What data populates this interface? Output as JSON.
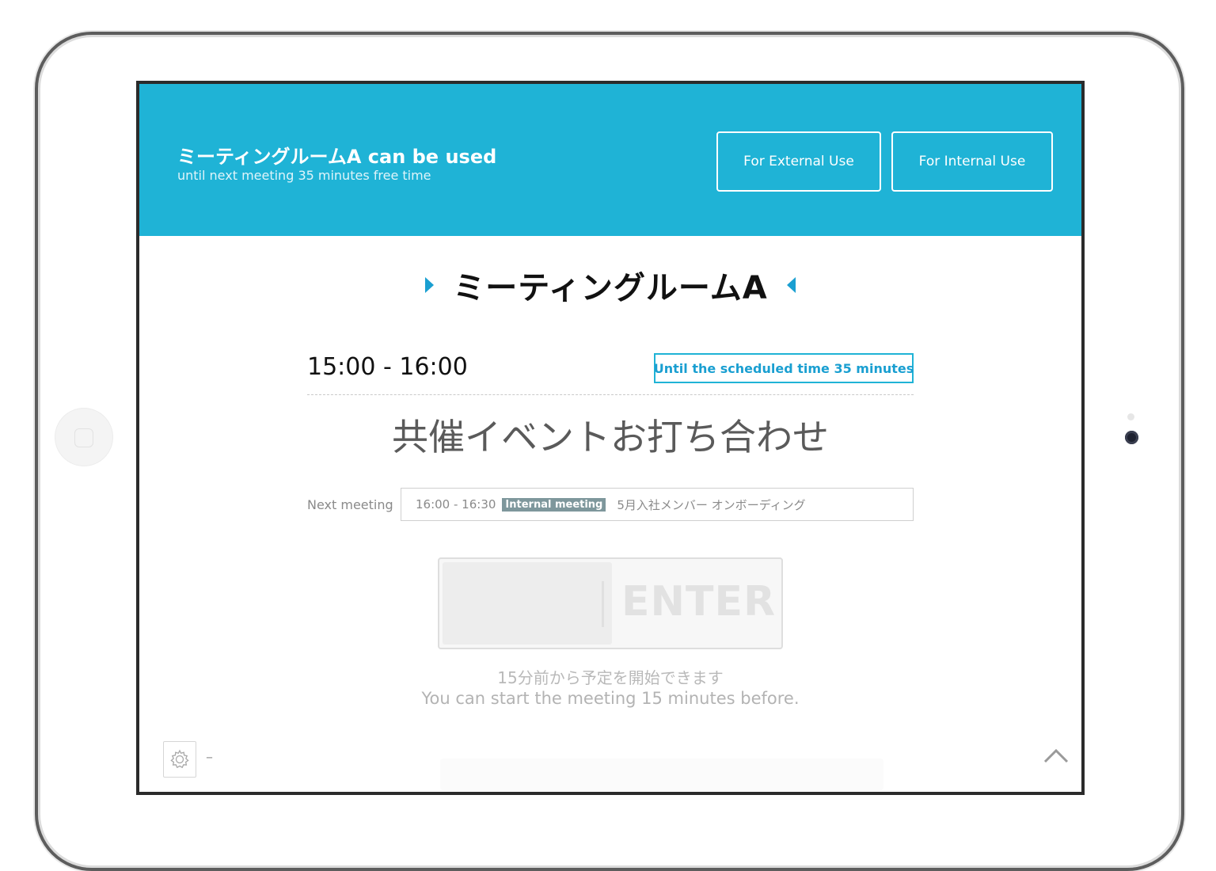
{
  "header": {
    "title": "ミーティングルームA can be used",
    "subtitle": "until next meeting 35 minutes free time",
    "external_button": "For External Use",
    "internal_button": "For Internal Use",
    "bg_color": "#1fb3d6"
  },
  "room": {
    "name": "ミーティングルームA",
    "arrow_color": "#1a9fd1"
  },
  "current_meeting": {
    "time_range": "15:00 - 16:00",
    "until_badge": "Until the scheduled time 35 minutes",
    "title": "共催イベントお打ち合わせ"
  },
  "next_meeting": {
    "label": "Next meeting",
    "time": "16:00 - 16:30",
    "tag": "Internal meeting",
    "name": "5月入社メンバー オンボーディング"
  },
  "enter_slider": {
    "label": "ENTER",
    "hint_jp": "15分前から予定を開始できます",
    "hint_en": "You can start the meeting 15 minutes before."
  },
  "footer": {
    "settings_icon": "gear-icon",
    "settings_value": "–",
    "scroll_icon": "chevron-up-icon"
  }
}
